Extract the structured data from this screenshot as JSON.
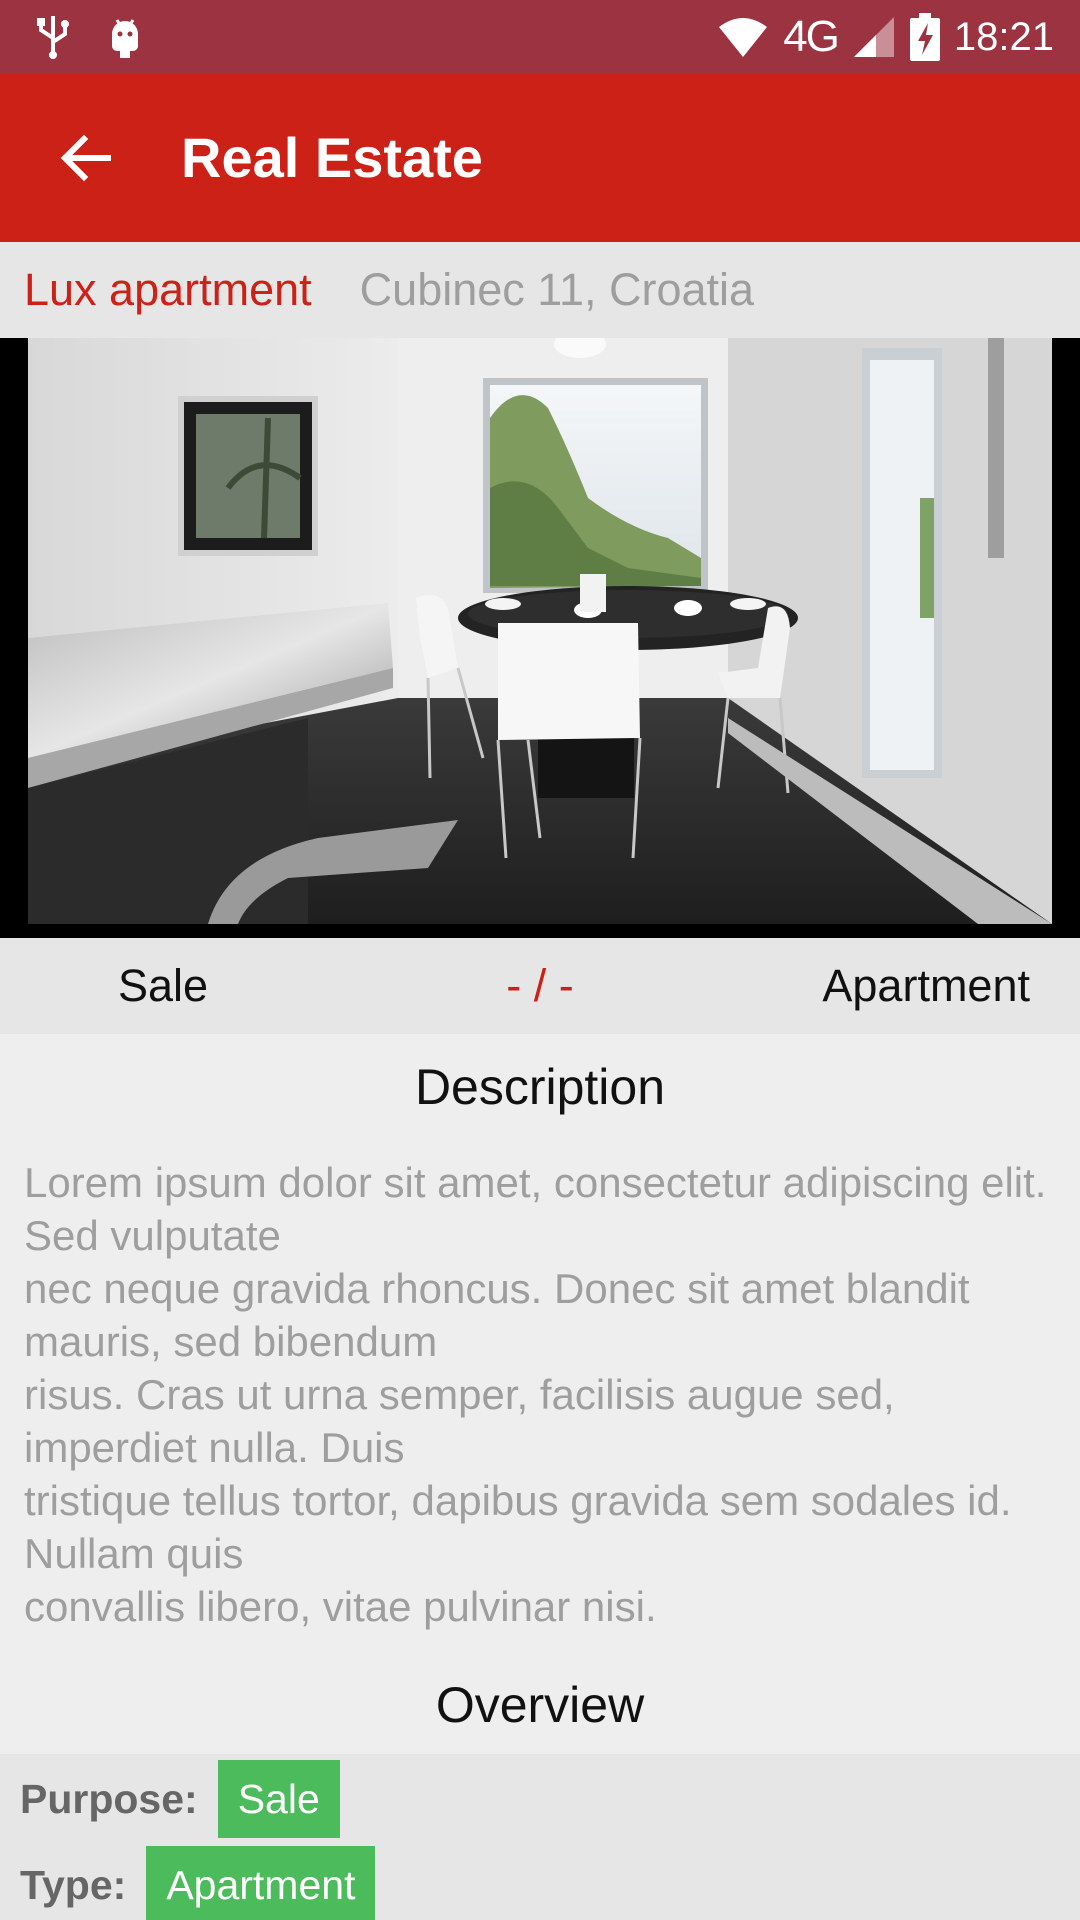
{
  "status_bar": {
    "time": "18:21",
    "network": "4G",
    "icons": [
      "usb-icon",
      "android-icon",
      "wifi-icon",
      "signal-icon",
      "battery-charging-icon"
    ]
  },
  "app_bar": {
    "title": "Real Estate",
    "back_icon": "arrow-back-icon"
  },
  "listing": {
    "name": "Lux apartment",
    "address": "Cubinec 11, Croatia",
    "purpose": "Sale",
    "price": "- / -",
    "type": "Apartment"
  },
  "description": {
    "title": "Description",
    "text": "Lorem ipsum dolor sit amet, consectetur adipiscing elit. Sed vulputate\nnec neque gravida rhoncus. Donec sit amet blandit mauris, sed bibendum\nrisus. Cras ut urna semper, facilisis augue sed, imperdiet nulla. Duis\ntristique tellus tortor, dapibus gravida sem sodales id. Nullam quis\nconvallis libero, vitae pulvinar nisi."
  },
  "overview": {
    "title": "Overview",
    "purpose_label": "Purpose:",
    "purpose_value": "Sale",
    "type_label": "Type:",
    "type_value": "Apartment"
  },
  "colors": {
    "status_bar": "#9c3340",
    "app_bar": "#cc2116",
    "accent_red": "#cc2116",
    "chip_green": "#4cbb5b",
    "muted_text": "#9e9e9e"
  }
}
